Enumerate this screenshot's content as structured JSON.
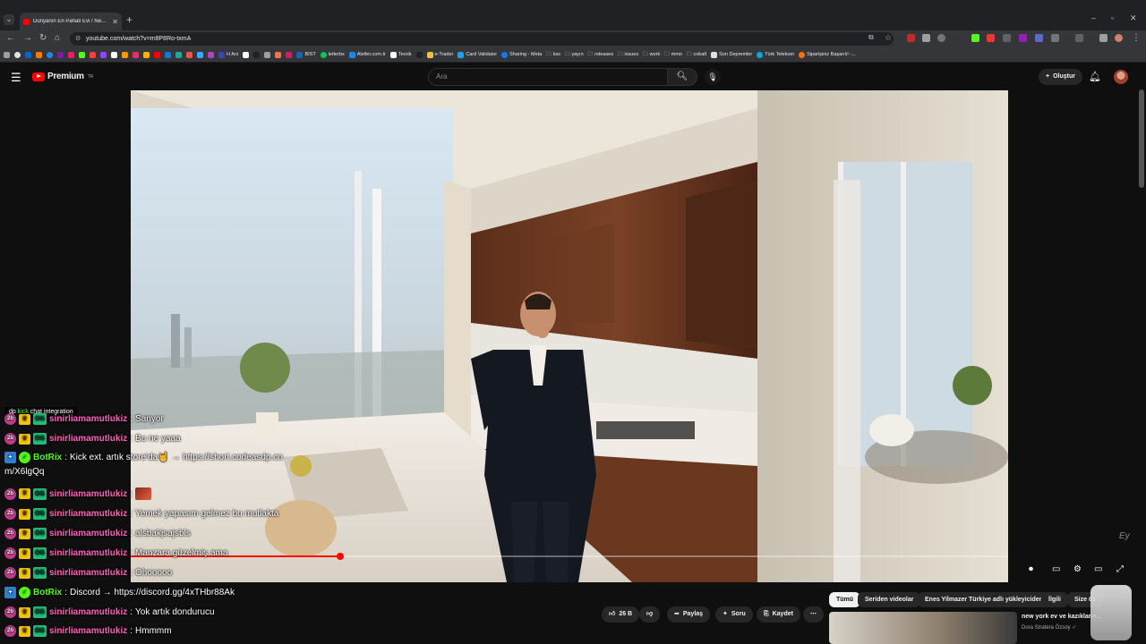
{
  "browser": {
    "tab_title": "Dünyanın En Pahalı Evi / New Y",
    "url": "youtube.com/watch?v=m8P8Ro-txmA",
    "bookmarks": [
      "H Arz",
      "BIST",
      "letterbx",
      "Aletler.com.tr",
      "Teorik",
      "e-Trader",
      "Card Validator",
      "Sharing - Meta",
      "kss",
      "yayın",
      "releases",
      "issues",
      "work",
      "mmo",
      "cobalt",
      "Son Depremler",
      "Türk Telekom",
      "Siparişiniz Başarılı! -..."
    ]
  },
  "youtube": {
    "logo_text": "Premium",
    "logo_sup": "TR",
    "search_placeholder": "Ara",
    "create_label": "Oluştur"
  },
  "player": {
    "progress": 0.239
  },
  "chat": {
    "label_prefix": "dp",
    "label_kick": "kick",
    "label_rest": "chat integration",
    "messages": [
      {
        "user": "sinirliamamutlukiz",
        "text": "Sanyor",
        "type": "sub"
      },
      {
        "user": "sinirliamamutlukiz",
        "text": "Bu ne yaaa",
        "type": "sub"
      },
      {
        "user": "BotRix",
        "text": "Kick ext. artık store'da🤘 → https://short.codeasdp.co",
        "wrap": "m/X6lgQq",
        "type": "bot"
      },
      {
        "user": "sinirliamamutlukiz",
        "text": "",
        "type": "sub",
        "emote": true
      },
      {
        "user": "sinirliamamutlukiz",
        "text": "Yemek yapasım gelmez bu mutlakta",
        "type": "sub"
      },
      {
        "user": "sinirliamamutlukiz",
        "text": "alsbakjsajsbls",
        "type": "sub"
      },
      {
        "user": "sinirliamamutlukiz",
        "text": "Manzara güzelmiş ama",
        "type": "sub"
      },
      {
        "user": "sinirliamamutlukiz",
        "text": "Ohooooo",
        "type": "sub"
      },
      {
        "user": "BotRix",
        "text": "Discord → https://discord.gg/4xTHbr88Ak",
        "type": "bot"
      },
      {
        "user": "sinirliamamutlukiz",
        "text": "Yok artık dondurucu",
        "type": "sub"
      },
      {
        "user": "sinirliamamutlukiz",
        "text": "Hmmmm",
        "type": "sub"
      }
    ]
  },
  "actions": {
    "likes": "26 B",
    "share": "Paylaş",
    "ask": "Soru",
    "save": "Kaydet"
  },
  "chips": [
    "Tümü",
    "Seriden videolar",
    "Enes Yilmazer Türkiye adlı yükleyiciden",
    "İlgili",
    "Size öz"
  ],
  "related": {
    "title": "new york ev ve kazıkların...",
    "channel": "Dora Stratera Özsoy ✓"
  }
}
